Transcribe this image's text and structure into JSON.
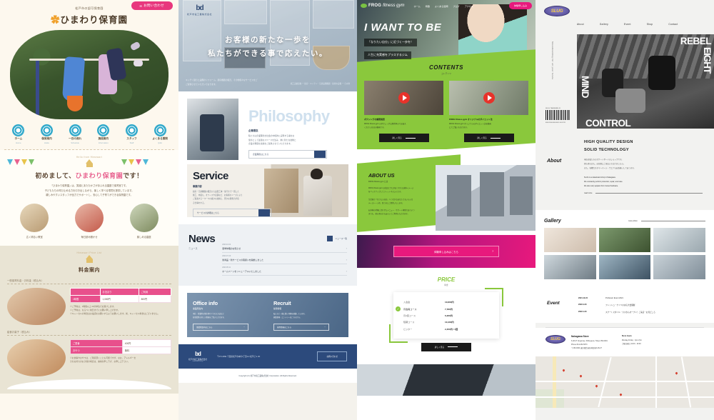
{
  "panels": {
    "nursery": {
      "contact_button": "お問い合わせ",
      "site_sub": "松戸市の認可保育園",
      "site_title": "ひまわり保育園",
      "nav": [
        {
          "ja": "ホーム",
          "en": "Home"
        },
        {
          "ja": "保育案内",
          "en": "Hoiku"
        },
        {
          "ja": "一日の流れ",
          "en": "Schedule"
        },
        {
          "ja": "施設案内",
          "en": "Information"
        },
        {
          "ja": "スタッフ",
          "en": "Staff"
        },
        {
          "ja": "よくある質問",
          "en": "Q&A"
        }
      ],
      "intro": {
        "ribbon": "Hello from Himawari",
        "heading_a": "初めまして、",
        "heading_b": "ひまわり保育園",
        "heading_c": "です！",
        "body_l1": "「ひまわり保育園」は、笑顔とあたたかさがあふれる園庭で保育室です。",
        "body_l2": "子どもたちの呼び止める力を引き出しながら、楽しく学べる環境を提供しています。",
        "body_l3": "親しみやすいスタッフが全力でサポートし、安心して子育てができる保育園です。",
        "features": [
          {
            "label": "広く明るい教室"
          },
          {
            "label": "毎日読み聞かせ"
          },
          {
            "label": "楽しめる園庭"
          }
        ]
      },
      "pricing": {
        "ribbon": "Himawari Price List",
        "heading": "料金案内",
        "section1_label": "一般保育料金・お料金（税込み）",
        "table1": {
          "columns": [
            "",
            "お泊まり",
            "ご利用"
          ],
          "rows": [
            {
              "label": "1時間",
              "cells": [
                "1,080円",
                "800円"
              ]
            }
          ]
        },
        "note1_l1": "※ご予約は、1時間以上 30分単位でお受けします。",
        "note1_l2": "※ご予約は、なるべく前日までにお願い申し上げます。",
        "note1_l3": "※キャンセルの場合はお電話をお願いするようお願いします。尚、キャンセル料金はございません。",
        "section2_label": "給食お菓子（税込み）",
        "table2": {
          "rows": [
            {
              "label": "ご昼食",
              "value": "400円"
            },
            {
              "label": "おやつ",
              "value": "無料"
            }
          ]
        },
        "note2_l1": "※お食事やおやつは、ご用意頂くことも可能ですが、なお、アレルギーを",
        "note2_l2": "子をお持ちのお子様の場合は、事前を申し下げ、お申し上下さい。"
      }
    },
    "corporate": {
      "logo_mark": "bd",
      "logo_name": "松戸市電工業株式会社",
      "hero_line1": "お客様の新たな一歩を",
      "hero_line2": "私たちができる事で応えたい。",
      "hero_caption_l1": "キッチン廻りと設備のリフォーム、厨房機器の販売、その他様々なサービスをご",
      "hero_caption_l2": "ご提供させていただいております。",
      "hero_caption_right": "施工実績多数 ー 厨房・キッチン・空調設備機器・給排水設備 ー その他",
      "philosophy": {
        "word": "Philosophy",
        "title": "企業理念",
        "body_l1": "私たちは企業理念を社会の中核的に実現する事をお",
        "body_l2": "使命として最適なスペースを生み、常に新たな技術と",
        "body_l3": "企業の発展を貢献をご提供させていただきます。",
        "button": "企業理念はこちら"
      },
      "service": {
        "title": "Service",
        "title_ja": "事業内容",
        "body_l1": "厨房・空調機器の販売から設置工事・保守まで一貫した",
        "body_l2": "施工、内装も、オフィスや店舗など、お客様のニーズにより",
        "body_l3": "ご提案する一つ一つの確かな技術と、豊かな発想力が宿",
        "body_l4": "る仕事をする。",
        "button": "サービスの詳細はこちら"
      },
      "news": {
        "title": "News",
        "title_ja": "ニュース",
        "more_label": "ニュース一覧",
        "items": [
          {
            "date": "2023.10.04",
            "title": "夏季休暇のお知らせ"
          },
          {
            "date": "2023.07.20",
            "title": "新商品・新サービスの取扱いを開始しました"
          },
          {
            "date": "2023.05.11",
            "title": "ホームページをリニューアルいたしました"
          }
        ]
      },
      "office": {
        "title": "Office info",
        "title_ja": "事業所案内",
        "body_l1": "本社・営業所の所在地やアクセス方法など",
        "body_l2": "各事業所の詳しい情報をご覧いただけます。",
        "button": "事業所案内はこちら"
      },
      "recruit": {
        "title": "Recruit",
        "title_ja": "採用情報",
        "body_l1": "私たちと一緒に働く仲間を募集しています。",
        "body_l2": "募集要項・エントリーはこちらから。",
        "button": "採用情報はこちら"
      },
      "footer": {
        "logo_mark": "bd",
        "logo_name": "松戸市電工業株式会社",
        "logo_url": "matsudo-d.co.jp",
        "address": "〒271-0091 千葉県松戸市本町1丁目2-3 松戸ビル 3F",
        "contact_button": "お問い合わせ",
        "copyright": "Copyright (C) 松戸市電工業株式会社 Corporation. All Rights Reserved."
      }
    },
    "gym": {
      "logo_text": "FROG",
      "logo_text2": "fitness gym",
      "nav": [
        "ホーム",
        "特徴",
        "よくある質問",
        "ブログ",
        "アクセス"
      ],
      "trial_button": "体験申し込み",
      "hero_big": "I WANT TO BE",
      "hero_sub1": "「なりたい自分」に近づく一歩を！",
      "hero_sub2": "人生に充実感をプラスするジム",
      "contents": {
        "title": "CONTENTS",
        "subtitle": "コンテンツ",
        "cards": [
          {
            "title": "ボクシングの練習風景",
            "body_l1": "FROG fitness gym のボクシング山場所中のでお伝え",
            "body_l2": "ください方法の動画です。",
            "button": "詳しく見る"
          },
          {
            "title": "FROG fitness gym オリジナルのダイエット法",
            "body_l1": "FROG fitness gym オリジナルのダイエット法を動画",
            "body_l2": "にてご覧いただけます。",
            "button": "詳しく見る"
          }
        ]
      },
      "about": {
        "title": "ABOUT US",
        "subtitle": "FROG fitness gym とは",
        "body_l1": "FROG fitness gym は社員とプロがあつかえる身体イメージ",
        "body_l2": "をバックアップしてフィットネスジムです。",
        "body_l3": "生活筋が「なりたい自分」へつながるあなたでもいろんな",
        "body_l4": "ティストーン的、皆さまにご提供いたします。",
        "body_l5": "お身体の状態に合わせたメニュー・サポート体制でありいつ",
        "body_l6": "までも、初心者の方も安心してご利用いただけます。"
      },
      "cta_button": "体験申し込みはこちら",
      "price": {
        "title": "PRICE",
        "subtitle": "料金",
        "rows": [
          {
            "name": "入会金",
            "value": "10,800円",
            "highlight": false
          },
          {
            "name": "月会員コース",
            "value": "7,780円",
            "highlight": true
          },
          {
            "name": "月4回コース",
            "value": "6,260円",
            "highlight": false
          },
          {
            "name": "短期コース",
            "value": "10,400円",
            "highlight": false
          },
          {
            "name": "ビジター",
            "value": "2,450円 / 1回",
            "highlight": false
          }
        ],
        "button": "詳しく見る"
      }
    },
    "slug": {
      "logo": "SLUG",
      "nav": [
        "About",
        "Gallery",
        "Event",
        "Shop",
        "Contact"
      ],
      "vertical_text": "Skateboarding for all your future",
      "barcode_label": "SLUG  7SA1000NL-R",
      "barcode_no": "0000 1000 0000 00L1 0L02 111",
      "hero_words": {
        "rebel": "REBEL",
        "eight": "EIGHT",
        "mind": "MIND",
        "control": "CONTROL"
      },
      "about": {
        "label": "About",
        "headline_1": "HIGH QUALITY DESIGN",
        "headline_2": "SOLID TECHNOLOGY",
        "jp_l1": "当店は私たちのスケートボードのショップです。",
        "jp_l2": "初心者の方も、お気軽にご来店いただけましたら。",
        "jp_l3": "また、各種カスタマーパーツ・ウエアもお取扱いしております。",
        "en_l1": "SLUG is a skateboard shop in Nakagawa.",
        "en_l2": "We constantly perform protection, repair, and rules.",
        "en_l3": "We also carry apparel from trusted hardware.",
        "more_label": "read more"
      },
      "gallery": {
        "label": "Gallery",
        "more_label": "more photo"
      },
      "event": {
        "label": "Event",
        "items": [
          {
            "date": "2021.12.24",
            "title": "Professor Event 2021"
          },
          {
            "date": "2022.4.20",
            "title": "フレッシュ・ナイツのある大会開催"
          },
          {
            "date": "2022.1.20",
            "title": "スケートスタイル・カスタムオープン！ご来店・お見どころ"
          }
        ]
      },
      "store": {
        "name": "Nakagawa Store",
        "address_l1": "6-48-27 Jingumae, Shibuya-ku, Tokyo 150-0001",
        "address_l2": "Phone 03-1234-5673",
        "address_l3": "〒150-0001 東京都渋谷区神宮前6-48-27",
        "hours_label": "Store hours",
        "hours_l1": "Monday-Friday : 1pm-7pm",
        "hours_l2": "土曜日祝日 12:00 - 19:00"
      }
    }
  }
}
